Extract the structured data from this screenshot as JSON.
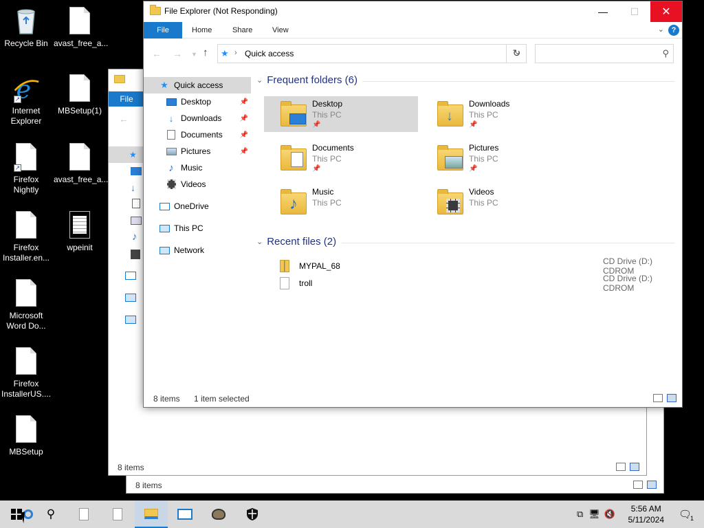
{
  "desktop_icons": [
    {
      "label": "Recycle Bin",
      "icon": "recycle-bin-icon"
    },
    {
      "label": "avast_free_a...",
      "icon": "document-icon"
    },
    {
      "label": "Internet Explorer",
      "icon": "internet-explorer-icon"
    },
    {
      "label": "MBSetup(1)",
      "icon": "document-icon"
    },
    {
      "label": "Firefox Nightly",
      "icon": "document-shortcut-icon"
    },
    {
      "label": "avast_free_a...",
      "icon": "document-icon"
    },
    {
      "label": "Firefox Installer.en...",
      "icon": "document-icon"
    },
    {
      "label": "wpeinit",
      "icon": "text-file-icon"
    },
    {
      "label": "Microsoft Word Do...",
      "icon": "document-icon"
    },
    {
      "label": "Firefox InstallerUS....",
      "icon": "document-icon"
    },
    {
      "label": "MBSetup",
      "icon": "document-icon"
    }
  ],
  "back_window_1": {
    "file_tab": "File",
    "status": "8 items"
  },
  "back_window_2": {
    "status": "8 items"
  },
  "window": {
    "title": "File Explorer (Not Responding)",
    "controls": {
      "minimize": "—",
      "maximize": "☐",
      "close": "✕"
    },
    "ribbon_tabs": [
      "File",
      "Home",
      "Share",
      "View"
    ],
    "address": {
      "location": "Quick access",
      "search_placeholder": ""
    },
    "nav_pane": [
      {
        "label": "Quick access",
        "icon": "star-icon",
        "pinned": false
      },
      {
        "label": "Desktop",
        "icon": "desktop-icon",
        "pinned": true
      },
      {
        "label": "Downloads",
        "icon": "download-icon",
        "pinned": true
      },
      {
        "label": "Documents",
        "icon": "documents-icon",
        "pinned": true
      },
      {
        "label": "Pictures",
        "icon": "pictures-icon",
        "pinned": true
      },
      {
        "label": "Music",
        "icon": "music-icon",
        "pinned": false
      },
      {
        "label": "Videos",
        "icon": "videos-icon",
        "pinned": false
      },
      {
        "label": "OneDrive",
        "icon": "onedrive-icon",
        "pinned": false
      },
      {
        "label": "This PC",
        "icon": "this-pc-icon",
        "pinned": false
      },
      {
        "label": "Network",
        "icon": "network-icon",
        "pinned": false
      }
    ],
    "frequent_header": "Frequent folders (6)",
    "frequent_folders": [
      {
        "name": "Desktop",
        "location": "This PC",
        "pinned": true
      },
      {
        "name": "Downloads",
        "location": "This PC",
        "pinned": true
      },
      {
        "name": "Documents",
        "location": "This PC",
        "pinned": true
      },
      {
        "name": "Pictures",
        "location": "This PC",
        "pinned": true
      },
      {
        "name": "Music",
        "location": "This PC",
        "pinned": false
      },
      {
        "name": "Videos",
        "location": "This PC",
        "pinned": false
      }
    ],
    "recent_header": "Recent files (2)",
    "recent_files": [
      {
        "name": "MYPAL_68",
        "location": "CD Drive (D:) CDROM",
        "icon": "zip-icon"
      },
      {
        "name": "troll",
        "location": "CD Drive (D:) CDROM",
        "icon": "blank-file-icon"
      }
    ],
    "status": {
      "items": "8 items",
      "selected": "1 item selected"
    }
  },
  "taskbar": {
    "clock_time": "5:56 AM",
    "clock_date": "5/11/2024",
    "notification_count": "1"
  },
  "colors": {
    "accent": "#1979ca",
    "close_red": "#e81123",
    "header_blue": "#1e3287"
  }
}
